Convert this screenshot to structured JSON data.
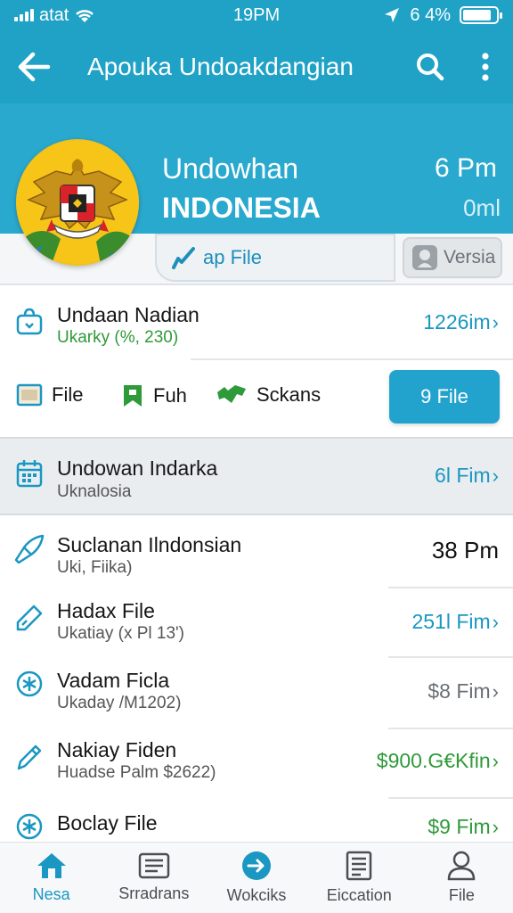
{
  "status": {
    "carrier": "atat",
    "time": "19PM",
    "battery": "6 4%"
  },
  "appbar": {
    "title": "Apouka Undoakdangian"
  },
  "hero": {
    "title": "Undowhan",
    "subtitle": "INDONESIA",
    "time": "6 Pm",
    "size": "0ml",
    "file_button": "ap File",
    "versia_button": "Versia"
  },
  "rows": [
    {
      "title": "Undaan Nadian",
      "subtitle": "Ukarky (%, 230)",
      "value": "1226im",
      "value_color": "#1a97c2",
      "subtitle_color": "#2f9a3a"
    },
    {
      "title": "Undowan Indarka",
      "subtitle": "Uknalosia",
      "value": "6l Fim",
      "value_color": "#1a97c2"
    },
    {
      "title": "Suclanan Ilndonsian",
      "subtitle": "Uki, Fiika)",
      "value": "38 Pm",
      "value_color": "#111111"
    },
    {
      "title": "Hadax File",
      "subtitle": "Ukatiay (x Pl 13')",
      "value": "251l Fim",
      "value_color": "#1a97c2"
    },
    {
      "title": "Vadam Ficla",
      "subtitle": "Ukaday /M1202)",
      "value": "$8 Fim",
      "value_color": "#6a6f74"
    },
    {
      "title": "Nakiay Fiden",
      "subtitle": "Huadse Palm $2622)",
      "value": "$900.G€Kfin",
      "value_color": "#2f9a3a"
    },
    {
      "title": "Boclay File",
      "subtitle": "",
      "value": "$9 Fim",
      "value_color": "#2f9a3a"
    }
  ],
  "filters": {
    "file": "File",
    "fuh": "Fuh",
    "sckans": "Sckans",
    "nine_file": "9 File"
  },
  "nav": [
    {
      "label": "Nesa",
      "icon": "home-icon",
      "active": true
    },
    {
      "label": "Srradrans",
      "icon": "list-icon",
      "active": false
    },
    {
      "label": "Wokciks",
      "icon": "navigate-icon",
      "active": false
    },
    {
      "label": "Eiccation",
      "icon": "document-icon",
      "active": false
    },
    {
      "label": "File",
      "icon": "profile-icon",
      "active": false
    }
  ],
  "colors": {
    "primary": "#1fa2c6",
    "accent_blue": "#1a97c2",
    "accent_green": "#2f9a3a"
  }
}
